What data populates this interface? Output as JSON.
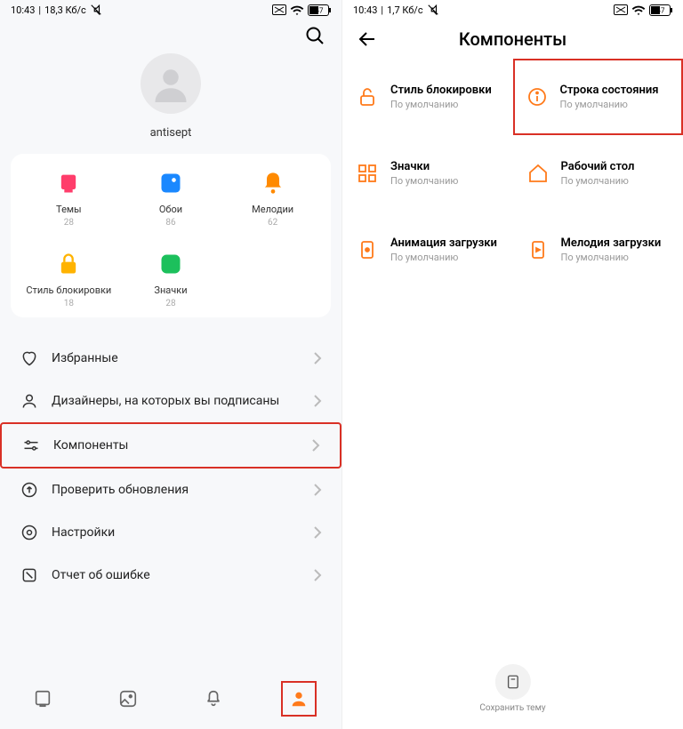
{
  "left": {
    "status": {
      "time": "10:43",
      "speed": "18,3 Кб/с",
      "battery": "47"
    },
    "profile": {
      "username": "antisept"
    },
    "grid": [
      {
        "label": "Темы",
        "count": "28",
        "icon": "themes",
        "color": "#ff3d6b"
      },
      {
        "label": "Обои",
        "count": "86",
        "icon": "wallpaper",
        "color": "#1a88ff"
      },
      {
        "label": "Мелодии",
        "count": "62",
        "icon": "ringtone",
        "color": "#ff8a00"
      },
      {
        "label": "Стиль блокировки",
        "count": "18",
        "icon": "lock",
        "color": "#ffb300"
      },
      {
        "label": "Значки",
        "count": "28",
        "icon": "icons",
        "color": "#1cc05c"
      }
    ],
    "menu": [
      {
        "label": "Избранные",
        "icon": "heart"
      },
      {
        "label": "Дизайнеры, на которых вы подписаны",
        "icon": "person"
      },
      {
        "label": "Компоненты",
        "icon": "sliders",
        "highlight": true
      },
      {
        "label": "Проверить обновления",
        "icon": "update"
      },
      {
        "label": "Настройки",
        "icon": "settings"
      },
      {
        "label": "Отчет об ошибке",
        "icon": "report"
      }
    ]
  },
  "right": {
    "status": {
      "time": "10:43",
      "speed": "1,7 Кб/с",
      "battery": "47"
    },
    "title": "Компоненты",
    "default_text": "По умолчанию",
    "components": [
      {
        "label": "Стиль блокировки",
        "icon": "lock2"
      },
      {
        "label": "Строка состояния",
        "icon": "info",
        "highlight": true
      },
      {
        "label": "Значки",
        "icon": "grid4"
      },
      {
        "label": "Рабочий стол",
        "icon": "home"
      },
      {
        "label": "Анимация загрузки",
        "icon": "boot"
      },
      {
        "label": "Мелодия загрузки",
        "icon": "bootsound"
      }
    ],
    "save": "Сохранить тему"
  }
}
